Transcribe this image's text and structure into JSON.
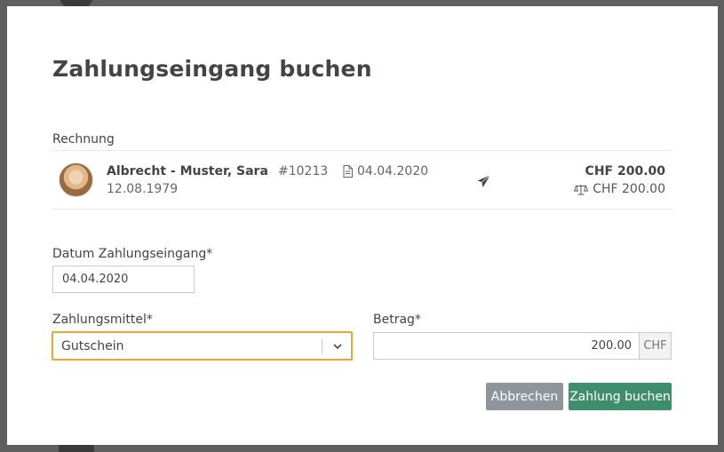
{
  "dialog": {
    "title": "Zahlungseingang buchen",
    "section_label": "Rechnung"
  },
  "invoice": {
    "patient_name": "Albrecht - Muster, Sara",
    "patient_dob": "12.08.1979",
    "invoice_number": "#10213",
    "invoice_date": "04.04.2020",
    "amount": "CHF 200.00",
    "balance": "CHF 200.00",
    "icons": [
      "document-icon",
      "send-icon",
      "balance-scale-icon"
    ]
  },
  "form": {
    "date_label": "Datum Zahlungseingang*",
    "date_value": "04.04.2020",
    "payment_method_label": "Zahlungsmittel*",
    "payment_method_value": "Gutschein",
    "amount_label": "Betrag*",
    "amount_value": "200.00",
    "currency": "CHF"
  },
  "actions": {
    "cancel_label": "Abbrechen",
    "submit_label": "Zahlung buchen"
  },
  "colors": {
    "focus_border": "#e7a73b",
    "submit_bg": "#3e8e6e",
    "cancel_bg": "#8e959b"
  }
}
